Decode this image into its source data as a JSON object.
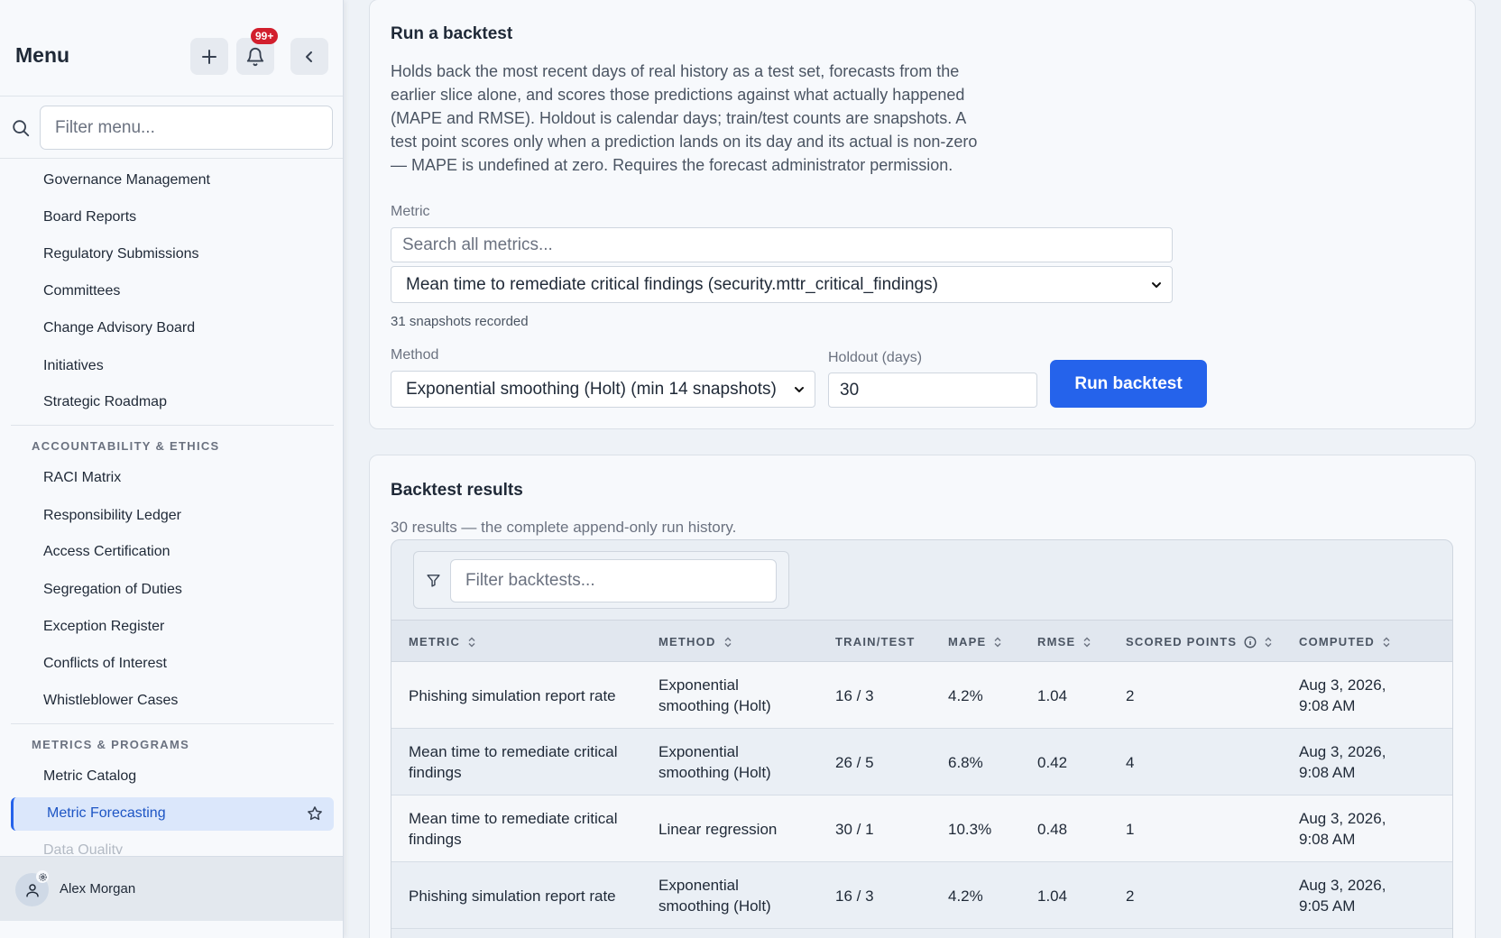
{
  "sidebar": {
    "title": "Menu",
    "notifications_badge": "99+",
    "filter_placeholder": "Filter menu...",
    "items_top": [
      "Governance Management",
      "Board Reports",
      "Regulatory Submissions",
      "Committees",
      "Change Advisory Board",
      "Initiatives",
      "Strategic Roadmap"
    ],
    "section_accountability": "ACCOUNTABILITY & ETHICS",
    "items_accountability": [
      "RACI Matrix",
      "Responsibility Ledger",
      "Access Certification",
      "Segregation of Duties",
      "Exception Register",
      "Conflicts of Interest",
      "Whistleblower Cases"
    ],
    "section_metrics": "METRICS & PROGRAMS",
    "items_metrics": [
      "Metric Catalog"
    ],
    "active_item": "Metric Forecasting",
    "partial_item": "Data Quality",
    "user_name": "Alex Morgan"
  },
  "backtest": {
    "title": "Run a backtest",
    "description": "Holds back the most recent days of real history as a test set, forecasts from the earlier slice alone, and scores those predictions against what actually happened (MAPE and RMSE). Holdout is calendar days; train/test counts are snapshots. A test point scores only when a prediction lands on its day and its actual is non-zero — MAPE is undefined at zero. Requires the forecast administrator permission.",
    "metric_label": "Metric",
    "metric_search_placeholder": "Search all metrics...",
    "metric_selected": "Mean time to remediate critical findings (security.mttr_critical_findings)",
    "snapshots_note": "31 snapshots recorded",
    "method_label": "Method",
    "method_selected": "Exponential smoothing (Holt) (min 14 snapshots)",
    "holdout_label": "Holdout (days)",
    "holdout_value": "30",
    "run_button": "Run backtest"
  },
  "results": {
    "title": "Backtest results",
    "subtitle": "30 results — the complete append-only run history.",
    "filter_placeholder": "Filter backtests...",
    "columns": {
      "metric": "METRIC",
      "method": "METHOD",
      "train_test": "TRAIN/TEST",
      "mape": "MAPE",
      "rmse": "RMSE",
      "scored_points": "SCORED POINTS",
      "computed": "COMPUTED"
    },
    "rows": [
      {
        "metric": [
          "Phishing simulation report rate"
        ],
        "method": [
          "Exponential",
          "smoothing (Holt)"
        ],
        "train_test": "16 / 3",
        "mape": "4.2%",
        "rmse": "1.04",
        "scored": "2",
        "computed": [
          "Aug 3, 2026,",
          "9:08 AM"
        ]
      },
      {
        "metric": [
          "Mean time to remediate critical",
          "findings"
        ],
        "method": [
          "Exponential",
          "smoothing (Holt)"
        ],
        "train_test": "26 / 5",
        "mape": "6.8%",
        "rmse": "0.42",
        "scored": "4",
        "computed": [
          "Aug 3, 2026,",
          "9:08 AM"
        ]
      },
      {
        "metric": [
          "Mean time to remediate critical",
          "findings"
        ],
        "method": [
          "Linear regression"
        ],
        "train_test": "30 / 1",
        "mape": "10.3%",
        "rmse": "0.48",
        "scored": "1",
        "computed": [
          "Aug 3, 2026,",
          "9:08 AM"
        ]
      },
      {
        "metric": [
          "Phishing simulation report rate"
        ],
        "method": [
          "Exponential",
          "smoothing (Holt)"
        ],
        "train_test": "16 / 3",
        "mape": "4.2%",
        "rmse": "1.04",
        "scored": "2",
        "computed": [
          "Aug 3, 2026,",
          "9:05 AM"
        ]
      }
    ]
  }
}
